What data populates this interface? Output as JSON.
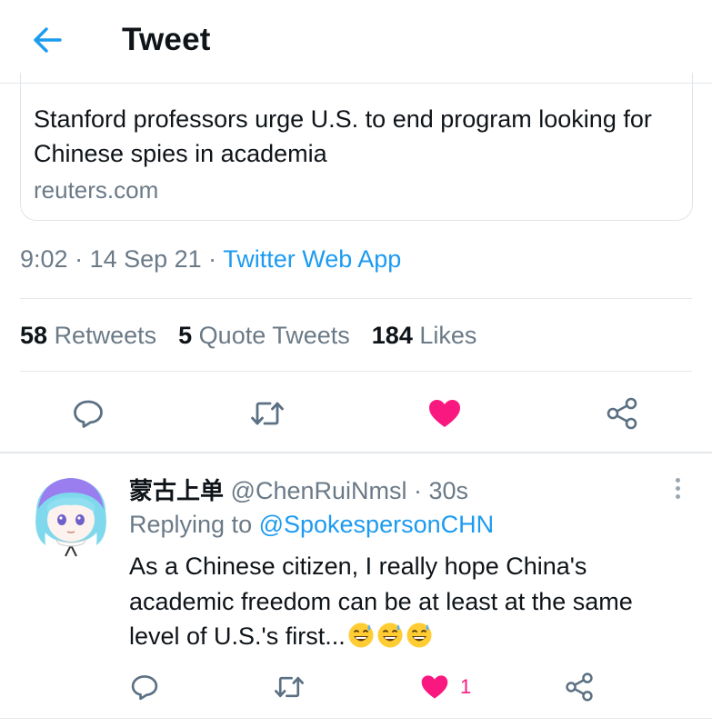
{
  "header": {
    "title": "Tweet",
    "back_icon": "back-arrow-icon"
  },
  "card": {
    "headline": "Stanford professors urge U.S. to end program looking for Chinese spies in academia",
    "domain": "reuters.com"
  },
  "meta": {
    "time": "9:02",
    "sep1": " · ",
    "date": "14 Sep 21",
    "sep2": " · ",
    "source": "Twitter Web App"
  },
  "stats": [
    {
      "count": "58",
      "label": "Retweets"
    },
    {
      "count": "5",
      "label": "Quote Tweets"
    },
    {
      "count": "184",
      "label": "Likes"
    }
  ],
  "actions": {
    "reply": "reply-icon",
    "retweet": "retweet-icon",
    "like": "heart-filled-icon",
    "share": "share-icon"
  },
  "reply": {
    "name": "蒙古上单",
    "handle": "@ChenRuiNmsl",
    "sep": " · ",
    "time": "30s",
    "replying_prefix": "Replying to ",
    "replying_to": "@SpokespersonCHN",
    "text": "As a Chinese citizen, I really hope China's academic freedom can be at least at the same level of U.S.'s  first...",
    "emojis": [
      "grinning-sweat-emoji",
      "grinning-sweat-emoji",
      "grinning-sweat-emoji"
    ],
    "like_count": "1"
  },
  "colors": {
    "accent": "#1d9bf0",
    "like": "#f91880",
    "muted": "#6b7a87",
    "text": "#0f1419"
  }
}
